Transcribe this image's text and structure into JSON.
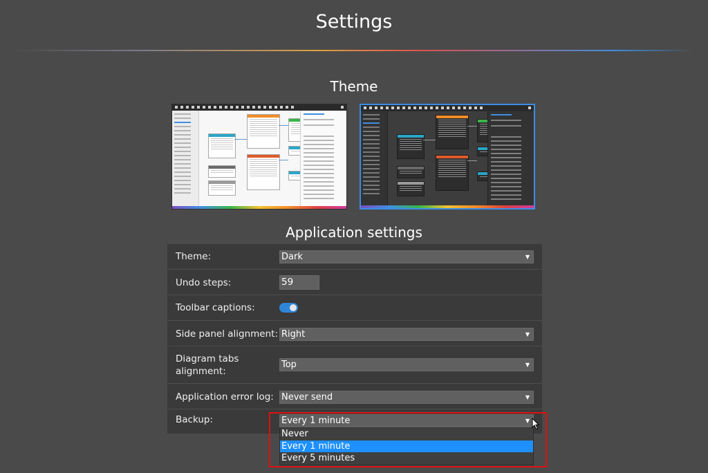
{
  "header": {
    "title": "Settings"
  },
  "theme": {
    "title": "Theme",
    "options": [
      {
        "name": "light",
        "selected": false
      },
      {
        "name": "dark",
        "selected": true
      }
    ],
    "selected_color": "#3a8ee6"
  },
  "app_settings": {
    "title": "Application settings",
    "theme": {
      "label": "Theme:",
      "value": "Dark"
    },
    "undo_steps": {
      "label": "Undo steps:",
      "value": "59"
    },
    "toolbar_captions": {
      "label": "Toolbar captions:",
      "enabled": true
    },
    "side_panel": {
      "label": "Side panel alignment:",
      "value": "Right"
    },
    "diagram_tabs": {
      "label": "Diagram tabs alignment:",
      "value": "Top"
    },
    "error_log": {
      "label": "Application error log:",
      "value": "Never send"
    },
    "backup": {
      "label": "Backup:",
      "value": "Every 1 minute",
      "options": [
        "Never",
        "Every 1 minute",
        "Every 5 minutes"
      ],
      "active_index": 1
    }
  },
  "colors": {
    "background": "#4a4a4a",
    "panel": "#3a3a3a",
    "accent": "#1e90ff",
    "highlight": "#e01010"
  }
}
